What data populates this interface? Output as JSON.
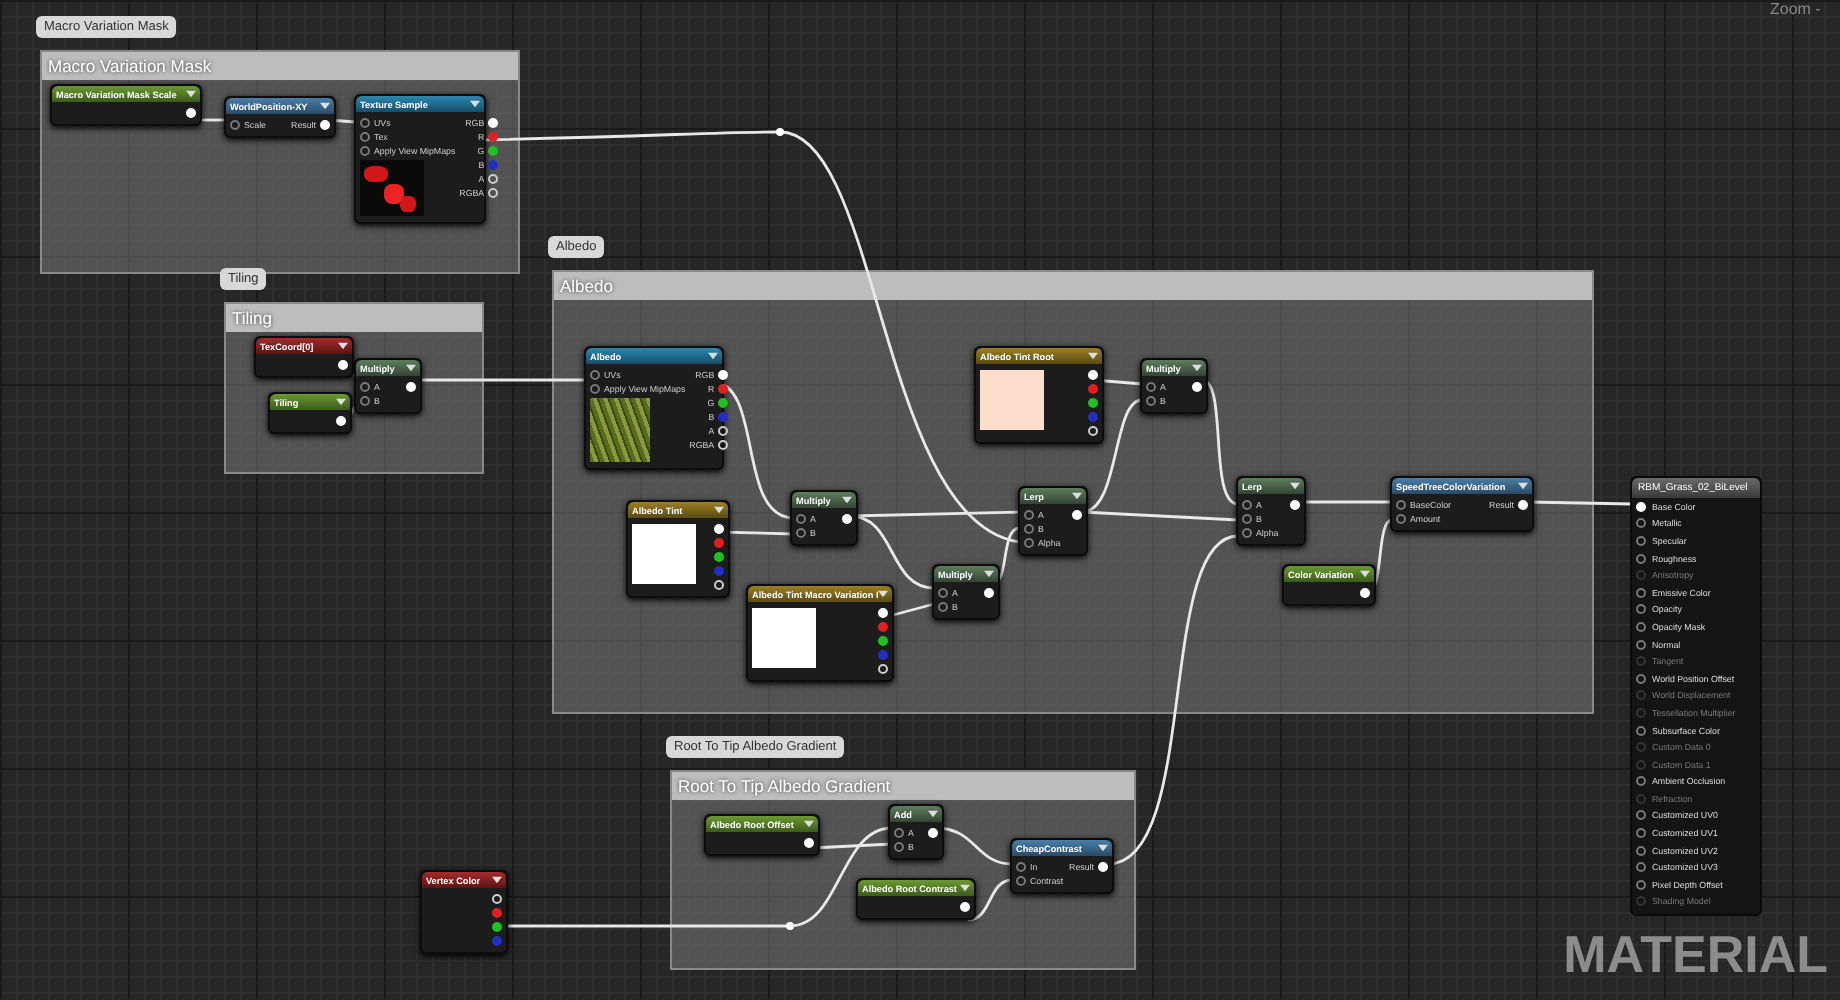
{
  "zoom_label": "Zoom -",
  "graph_label": "MATERIAL",
  "groups": [
    {
      "comment": "Macro Variation Mask",
      "title": "Macro Variation Mask"
    },
    {
      "comment": "Tiling",
      "title": "Tiling"
    },
    {
      "comment": "Albedo",
      "title": "Albedo"
    },
    {
      "comment": "Root To Tip Albedo Gradient",
      "title": "Root To Tip Albedo Gradient"
    }
  ],
  "nodes": [
    {
      "title": "Macro Variation Mask Scale",
      "kind": "scalar",
      "outputs": [
        {
          "kind": "white"
        }
      ]
    },
    {
      "title": "WorldPosition-XY",
      "kind": "function",
      "inputs": [
        "Scale"
      ],
      "outputs": [
        {
          "label": "Result",
          "kind": "white"
        }
      ]
    },
    {
      "title": "Texture Sample",
      "kind": "texture",
      "inputs": [
        "UVs",
        "Tex",
        "Apply View MipMaps"
      ],
      "outputs": [
        {
          "label": "RGB",
          "kind": "white"
        },
        {
          "label": "R",
          "kind": "red"
        },
        {
          "label": "G",
          "kind": "green"
        },
        {
          "label": "B",
          "kind": "blue"
        },
        {
          "label": "A",
          "kind": "grey"
        },
        {
          "label": "RGBA",
          "kind": "grey"
        }
      ],
      "preview": {
        "kind": "mask"
      }
    },
    {
      "title": "TexCoord[0]",
      "kind": "coordinate",
      "outputs": [
        {
          "kind": "white"
        }
      ]
    },
    {
      "title": "Tiling",
      "kind": "scalar",
      "outputs": [
        {
          "kind": "white"
        }
      ]
    },
    {
      "title": "Multiply",
      "kind": "math",
      "inputs": [
        "A",
        "B"
      ],
      "outputs": [
        {
          "kind": "white"
        }
      ]
    },
    {
      "title": "Albedo",
      "kind": "texture",
      "inputs": [
        "UVs",
        "Apply View MipMaps"
      ],
      "outputs": [
        {
          "label": "RGB",
          "kind": "white"
        },
        {
          "label": "R",
          "kind": "red"
        },
        {
          "label": "G",
          "kind": "green"
        },
        {
          "label": "B",
          "kind": "blue"
        },
        {
          "label": "A",
          "kind": "grey"
        },
        {
          "label": "RGBA",
          "kind": "grey"
        }
      ],
      "preview": {
        "kind": "grass"
      }
    },
    {
      "title": "Albedo Tint",
      "kind": "vector",
      "outputs": [
        {
          "kind": "white"
        },
        {
          "kind": "red"
        },
        {
          "kind": "green"
        },
        {
          "kind": "blue"
        },
        {
          "kind": "grey"
        }
      ],
      "preview": {
        "kind": "white"
      }
    },
    {
      "title": "Multiply",
      "kind": "math",
      "inputs": [
        "A",
        "B"
      ],
      "outputs": [
        {
          "kind": "white"
        }
      ]
    },
    {
      "title": "Albedo Tint Macro Variation I",
      "kind": "vector",
      "outputs": [
        {
          "kind": "white"
        },
        {
          "kind": "red"
        },
        {
          "kind": "green"
        },
        {
          "kind": "blue"
        },
        {
          "kind": "grey"
        }
      ],
      "preview": {
        "kind": "white"
      }
    },
    {
      "title": "Multiply",
      "kind": "math",
      "inputs": [
        "A",
        "B"
      ],
      "outputs": [
        {
          "kind": "white"
        }
      ]
    },
    {
      "title": "Albedo Tint Root",
      "kind": "vector",
      "outputs": [
        {
          "kind": "white"
        },
        {
          "kind": "red"
        },
        {
          "kind": "green"
        },
        {
          "kind": "blue"
        },
        {
          "kind": "grey"
        }
      ],
      "preview": {
        "kind": "peach"
      }
    },
    {
      "title": "Multiply",
      "kind": "math",
      "inputs": [
        "A",
        "B"
      ],
      "outputs": [
        {
          "kind": "white"
        }
      ]
    },
    {
      "title": "Lerp",
      "kind": "math",
      "inputs": [
        "A",
        "B",
        "Alpha"
      ],
      "outputs": [
        {
          "kind": "white"
        }
      ]
    },
    {
      "title": "Lerp",
      "kind": "math",
      "inputs": [
        "A",
        "B",
        "Alpha"
      ],
      "outputs": [
        {
          "kind": "white"
        }
      ]
    },
    {
      "title": "SpeedTreeColorVariation",
      "kind": "function",
      "inputs": [
        "BaseColor",
        "Amount"
      ],
      "outputs": [
        {
          "label": "Result",
          "kind": "white"
        }
      ]
    },
    {
      "title": "Color Variation",
      "kind": "scalar",
      "outputs": [
        {
          "kind": "white"
        }
      ]
    },
    {
      "title": "Vertex Color",
      "kind": "coordinate",
      "outputs": [
        {
          "kind": "grey"
        },
        {
          "kind": "red"
        },
        {
          "kind": "green"
        },
        {
          "kind": "blue"
        }
      ]
    },
    {
      "title": "Albedo Root Offset",
      "kind": "scalar",
      "outputs": [
        {
          "kind": "white"
        }
      ]
    },
    {
      "title": "Add",
      "kind": "math",
      "inputs": [
        "A",
        "B"
      ],
      "outputs": [
        {
          "kind": "white"
        }
      ]
    },
    {
      "title": "Albedo Root Contrast",
      "kind": "scalar",
      "outputs": [
        {
          "kind": "white"
        }
      ]
    },
    {
      "title": "CheapContrast",
      "kind": "function",
      "inputs": [
        "In",
        "Contrast"
      ],
      "outputs": [
        {
          "label": "Result",
          "kind": "white"
        }
      ]
    }
  ],
  "material_output": {
    "title": "RBM_Grass_02_BiLevel",
    "pins": [
      {
        "label": "Base Color",
        "disabled": false
      },
      {
        "label": "Metallic",
        "disabled": false
      },
      {
        "label": "Specular",
        "disabled": false
      },
      {
        "label": "Roughness",
        "disabled": false
      },
      {
        "label": "Anisotropy",
        "disabled": true
      },
      {
        "label": "Emissive Color",
        "disabled": false
      },
      {
        "label": "Opacity",
        "disabled": false
      },
      {
        "label": "Opacity Mask",
        "disabled": false
      },
      {
        "label": "Normal",
        "disabled": false
      },
      {
        "label": "Tangent",
        "disabled": true
      },
      {
        "label": "World Position Offset",
        "disabled": false
      },
      {
        "label": "World Displacement",
        "disabled": true
      },
      {
        "label": "Tessellation Multiplier",
        "disabled": true
      },
      {
        "label": "Subsurface Color",
        "disabled": false
      },
      {
        "label": "Custom Data 0",
        "disabled": true
      },
      {
        "label": "Custom Data 1",
        "disabled": true
      },
      {
        "label": "Ambient Occlusion",
        "disabled": false
      },
      {
        "label": "Refraction",
        "disabled": true
      },
      {
        "label": "Customized UV0",
        "disabled": false
      },
      {
        "label": "Customized UV1",
        "disabled": false
      },
      {
        "label": "Customized UV2",
        "disabled": false
      },
      {
        "label": "Customized UV3",
        "disabled": false
      },
      {
        "label": "Pixel Depth Offset",
        "disabled": false
      },
      {
        "label": "Shading Model",
        "disabled": true
      }
    ]
  }
}
